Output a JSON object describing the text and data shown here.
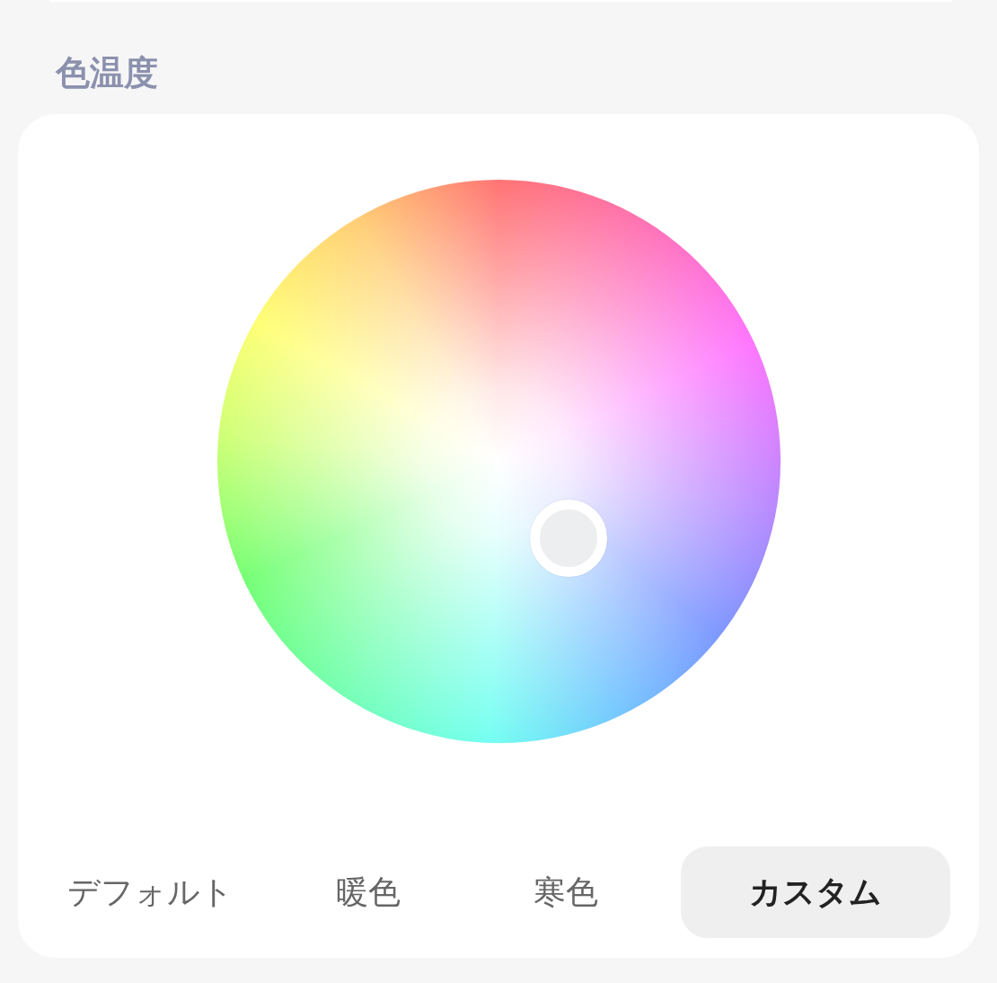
{
  "section": {
    "title": "色温度"
  },
  "presets": [
    {
      "label": "デフォルト",
      "selected": false
    },
    {
      "label": "暖色",
      "selected": false
    },
    {
      "label": "寒色",
      "selected": false
    },
    {
      "label": "カスタム",
      "selected": true
    }
  ]
}
